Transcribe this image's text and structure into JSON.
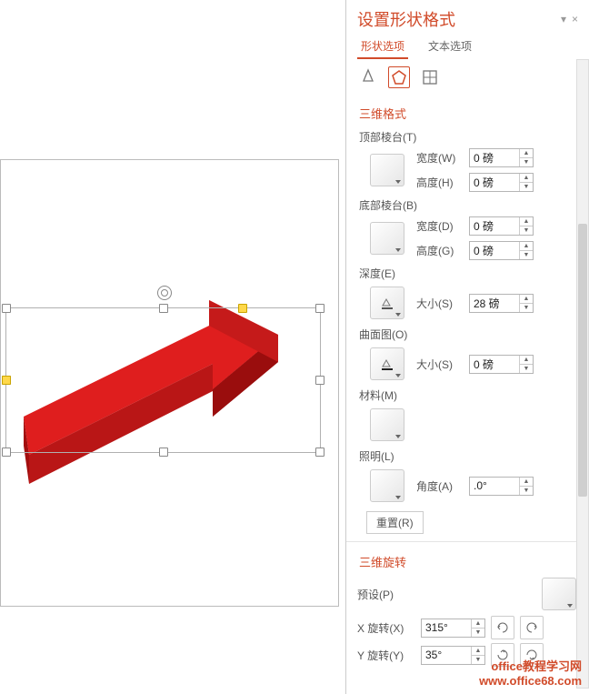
{
  "pane": {
    "title": "设置形状格式",
    "dropdown_char": "▾",
    "close_char": "×",
    "tabs": {
      "shape_options": "形状选项",
      "text_options": "文本选项"
    }
  },
  "section_3d_format": {
    "title": "三维格式",
    "top_bevel": {
      "label": "顶部棱台(T)",
      "width_label": "宽度(W)",
      "width_value": "0 磅",
      "height_label": "高度(H)",
      "height_value": "0 磅"
    },
    "bottom_bevel": {
      "label": "底部棱台(B)",
      "width_label": "宽度(D)",
      "width_value": "0 磅",
      "height_label": "高度(G)",
      "height_value": "0 磅"
    },
    "depth": {
      "label": "深度(E)",
      "size_label": "大小(S)",
      "size_value": "28 磅"
    },
    "contour": {
      "label": "曲面图(O)",
      "size_label": "大小(S)",
      "size_value": "0 磅"
    },
    "material": {
      "label": "材料(M)"
    },
    "lighting": {
      "label": "照明(L)",
      "angle_label": "角度(A)",
      "angle_value": ".0°"
    },
    "reset": "重置(R)"
  },
  "section_3d_rotation": {
    "title": "三维旋转",
    "preset": "预设(P)",
    "x_label": "X 旋转(X)",
    "x_value": "315°",
    "y_label": "Y 旋转(Y)",
    "y_value": "35°"
  },
  "watermark": {
    "line1": "office教程学习网",
    "line2": "www.office68.com"
  }
}
